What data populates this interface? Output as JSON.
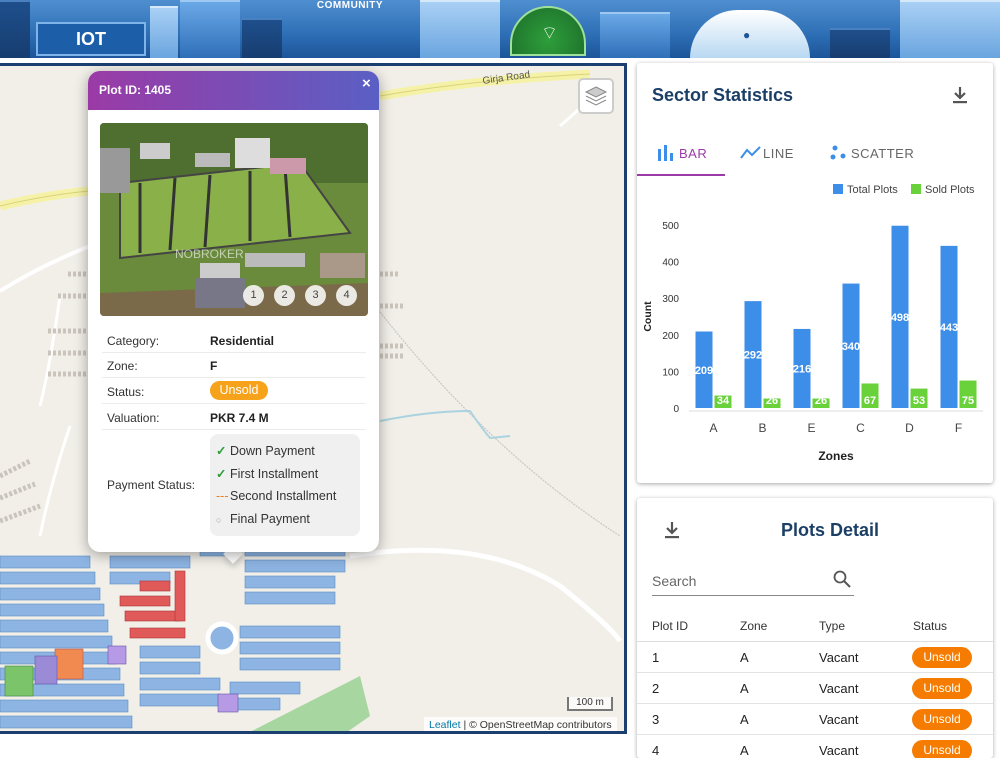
{
  "banner": {
    "iot_label": "IOT",
    "community_label": "COMMUNITY"
  },
  "map": {
    "road_label": "Girja Road",
    "scale_label": "100 m",
    "attribution_link": "Leaflet",
    "attribution_text": "| © OpenStreetMap contributors"
  },
  "popup": {
    "title": "Plot ID: 1405",
    "close": "×",
    "photo_watermark": "NOBROKER",
    "photo_dots": [
      "1",
      "2",
      "3",
      "4"
    ],
    "rows": [
      {
        "key": "Category:",
        "value": "Residential"
      },
      {
        "key": "Zone:",
        "value": "F"
      },
      {
        "key": "Status:",
        "value": "Unsold"
      },
      {
        "key": "Valuation:",
        "value": "PKR 7.4 M"
      }
    ],
    "payment_label": "Payment Status:",
    "payments": [
      {
        "icon": "✓",
        "label": "Down Payment",
        "state": "done"
      },
      {
        "icon": "✓",
        "label": "First Installment",
        "state": "done"
      },
      {
        "icon": "---",
        "label": "Second Installment",
        "state": "pending"
      },
      {
        "icon": "○",
        "label": "Final Payment",
        "state": "none"
      }
    ]
  },
  "stats": {
    "title": "Sector Statistics",
    "tabs": [
      {
        "label": "BAR"
      },
      {
        "label": "LINE"
      },
      {
        "label": "SCATTER"
      }
    ],
    "active_tab": "BAR"
  },
  "chart_data": {
    "type": "bar",
    "categories": [
      "A",
      "B",
      "E",
      "C",
      "D",
      "F"
    ],
    "series": [
      {
        "name": "Total Plots",
        "values": [
          209,
          292,
          216,
          340,
          498,
          443
        ],
        "color": "#3d8ee8"
      },
      {
        "name": "Sold Plots",
        "values": [
          34,
          26,
          26,
          67,
          53,
          75
        ],
        "color": "#69d23a"
      }
    ],
    "xlabel": "Zones",
    "ylabel": "Count",
    "yticks": [
      0,
      100,
      200,
      300,
      400,
      500
    ],
    "ylim": [
      0,
      500
    ],
    "legend_position": "top-right",
    "grid": false
  },
  "plots": {
    "title": "Plots Detail",
    "search_placeholder": "Search",
    "headers": [
      "Plot ID",
      "Zone",
      "Type",
      "Status"
    ],
    "rows": [
      [
        "1",
        "A",
        "Vacant",
        "Unsold"
      ],
      [
        "2",
        "A",
        "Vacant",
        "Unsold"
      ],
      [
        "3",
        "A",
        "Vacant",
        "Unsold"
      ],
      [
        "4",
        "A",
        "Vacant",
        "Unsold"
      ]
    ]
  },
  "colors": {
    "accent": "#9b3aa6",
    "title": "#1c3f66",
    "unsold": "#f57c00",
    "total": "#3d8ee8",
    "sold": "#69d23a"
  }
}
